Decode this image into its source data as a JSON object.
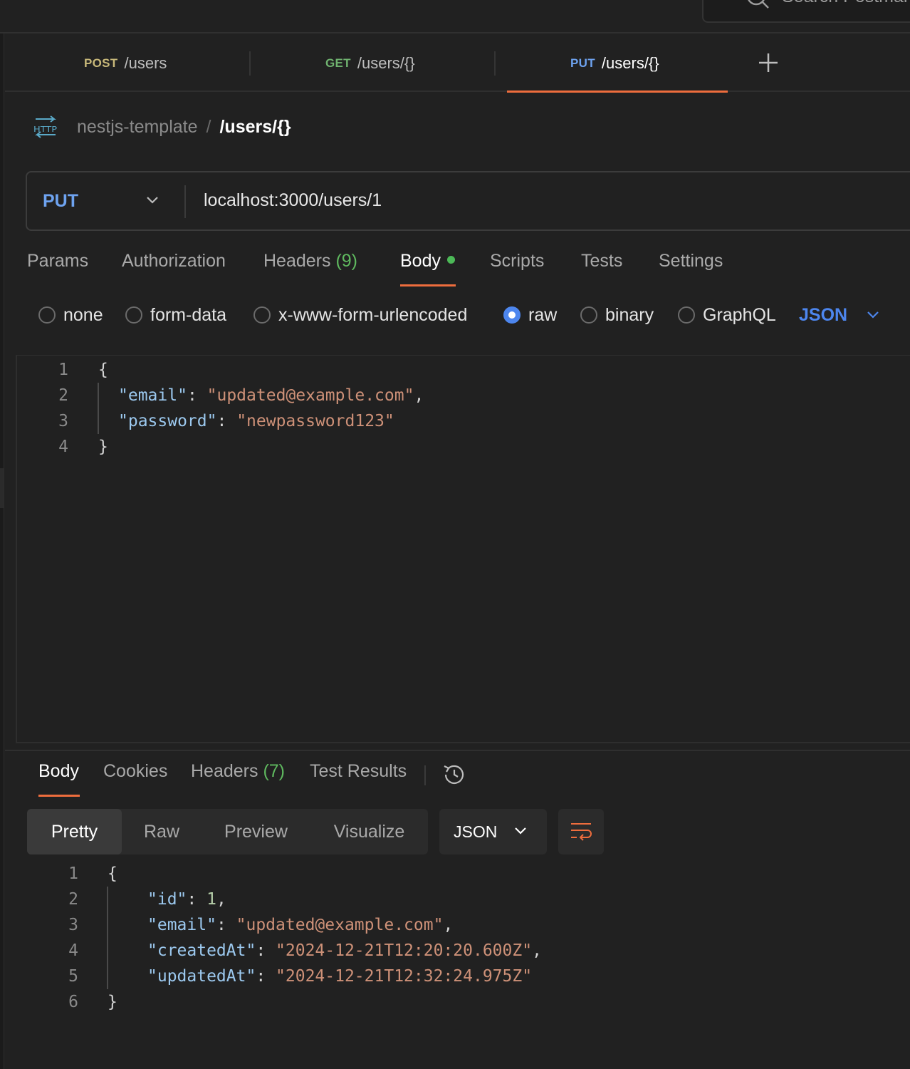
{
  "topbar": {
    "search_placeholder": "Search Postman"
  },
  "tabs": [
    {
      "method": "POST",
      "method_color": "#c9b97a",
      "path": "/users"
    },
    {
      "method": "GET",
      "method_color": "#6fb26f",
      "path": "/users/{}"
    },
    {
      "method": "PUT",
      "method_color": "#6ea3f0",
      "path": "/users/{}"
    }
  ],
  "breadcrumb": {
    "icon_text": "HTTP",
    "workspace": "nestjs-template",
    "separator": "/",
    "current": "/users/{}"
  },
  "request": {
    "method": "PUT",
    "url": "localhost:3000/users/1"
  },
  "request_tabs": {
    "params": "Params",
    "authorization": "Authorization",
    "headers": "Headers",
    "headers_count": "(9)",
    "body": "Body",
    "scripts": "Scripts",
    "tests": "Tests",
    "settings": "Settings"
  },
  "body_modes": {
    "none": "none",
    "form_data": "form-data",
    "urlencoded": "x-www-form-urlencoded",
    "raw": "raw",
    "binary": "binary",
    "graphql": "GraphQL",
    "selected": "raw",
    "language": "JSON"
  },
  "request_body": {
    "line_numbers": [
      "1",
      "2",
      "3",
      "4"
    ],
    "open_brace": "{",
    "close_brace": "}",
    "k1": "\"email\"",
    "v1": "\"updated@example.com\"",
    "k2": "\"password\"",
    "v2": "\"newpassword123\""
  },
  "response_tabs": {
    "body": "Body",
    "cookies": "Cookies",
    "headers": "Headers",
    "headers_count": "(7)",
    "test_results": "Test Results"
  },
  "response_format": {
    "pretty": "Pretty",
    "raw": "Raw",
    "preview": "Preview",
    "visualize": "Visualize",
    "language": "JSON"
  },
  "response_body": {
    "line_numbers": [
      "1",
      "2",
      "3",
      "4",
      "5",
      "6"
    ],
    "open_brace": "{",
    "close_brace": "}",
    "k1": "\"id\"",
    "v1": "1",
    "k2": "\"email\"",
    "v2": "\"updated@example.com\"",
    "k3": "\"createdAt\"",
    "v3": "\"2024-12-21T12:20:20.600Z\"",
    "k4": "\"updatedAt\"",
    "v4": "\"2024-12-21T12:32:24.975Z\""
  },
  "colors": {
    "accent": "#ee6d3d",
    "primary_blue": "#4d86ee",
    "success_green": "#4cb957"
  }
}
